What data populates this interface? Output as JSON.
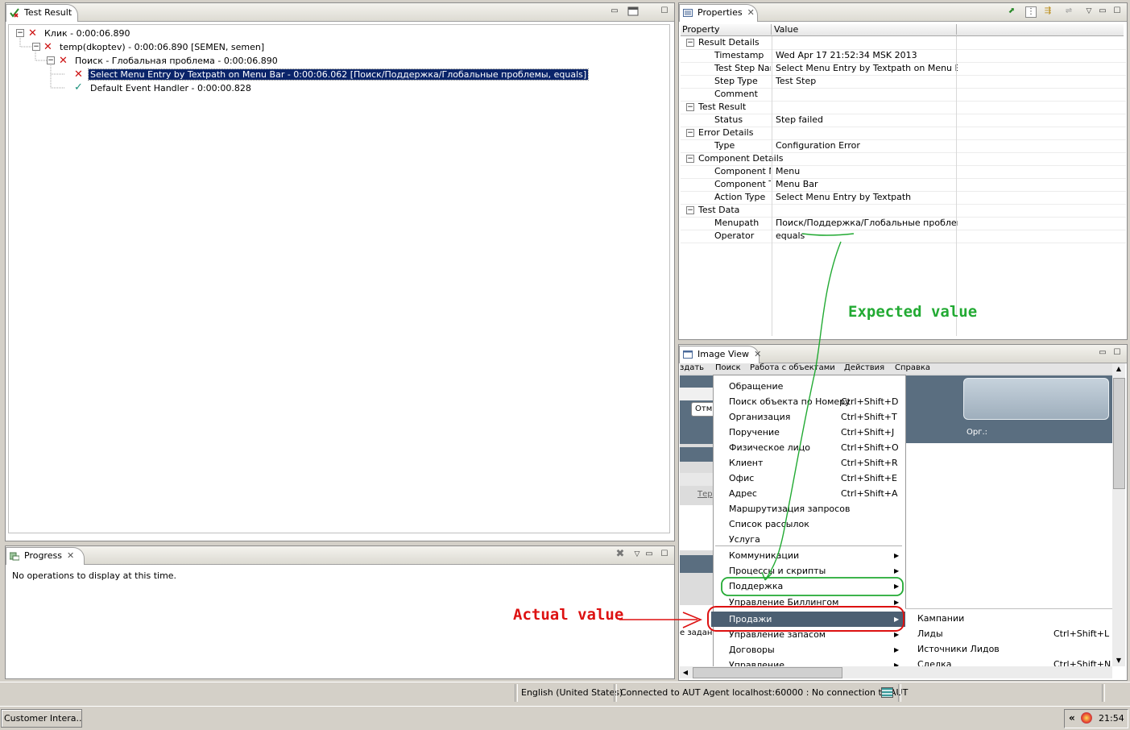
{
  "test_result": {
    "tab_title": "Test Result",
    "tree": [
      {
        "label": "Клик - 0:00:06.890",
        "status": "failed"
      },
      {
        "label": "temp(dkoptev) - 0:00:06.890 [SEMEN, semen]",
        "status": "failed"
      },
      {
        "label": "Поиск - Глобальная проблема - 0:00:06.890",
        "status": "failed"
      },
      {
        "label": "Select Menu Entry by Textpath on Menu Bar - 0:00:06.062 [Поиск/Поддержка/Глобальные проблемы, equals]",
        "status": "failed"
      },
      {
        "label": "Default Event Handler - 0:00:00.828",
        "status": "passed"
      }
    ]
  },
  "progress": {
    "tab_title": "Progress",
    "empty_text": "No operations to display at this time."
  },
  "properties": {
    "tab_title": "Properties",
    "col_property": "Property",
    "col_value": "Value",
    "groups": [
      {
        "name": "Result Details",
        "rows": [
          {
            "prop": "Timestamp",
            "value": "Wed Apr 17 21:52:34 MSK 2013"
          },
          {
            "prop": "Test Step Nam",
            "value": "Select Menu Entry by Textpath on Menu Bar"
          },
          {
            "prop": "Step Type",
            "value": "Test Step"
          },
          {
            "prop": "Comment",
            "value": ""
          }
        ]
      },
      {
        "name": "Test Result",
        "rows": [
          {
            "prop": "Status",
            "value": "Step failed"
          }
        ]
      },
      {
        "name": "Error Details",
        "rows": [
          {
            "prop": "Type",
            "value": "Configuration Error"
          }
        ]
      },
      {
        "name": "Component Details",
        "rows": [
          {
            "prop": "Component Na",
            "value": "Menu"
          },
          {
            "prop": "Component Ty",
            "value": "Menu Bar"
          },
          {
            "prop": "Action Type",
            "value": "Select Menu Entry by Textpath"
          }
        ]
      },
      {
        "name": "Test Data",
        "rows": [
          {
            "prop": "Menupath",
            "value": "Поиск/Поддержка/Глобальные проблемы"
          },
          {
            "prop": "Operator",
            "value": "equals"
          }
        ]
      }
    ]
  },
  "image_view": {
    "tab_title": "Image View",
    "menubar": [
      "здать",
      "Поиск",
      "Работа с объектами",
      "Действия",
      "Справка"
    ],
    "left_fragments": {
      "btn": "Отм",
      "link": "Тер",
      "text": "е задани"
    },
    "field_label": "Орг.:",
    "menu_items": [
      {
        "label": "Обращение",
        "shortcut": "",
        "sub": false
      },
      {
        "label": "Поиск объекта по  Номеру",
        "shortcut": "Ctrl+Shift+D",
        "sub": false
      },
      {
        "label": "Организация",
        "shortcut": "Ctrl+Shift+T",
        "sub": false
      },
      {
        "label": "Поручение",
        "shortcut": "Ctrl+Shift+J",
        "sub": false
      },
      {
        "label": "Физическое лицо",
        "shortcut": "Ctrl+Shift+O",
        "sub": false
      },
      {
        "label": "Клиент",
        "shortcut": "Ctrl+Shift+R",
        "sub": false
      },
      {
        "label": "Офис",
        "shortcut": "Ctrl+Shift+E",
        "sub": false
      },
      {
        "label": "Адрес",
        "shortcut": "Ctrl+Shift+A",
        "sub": false
      },
      {
        "label": "Маршрутизация запросов",
        "shortcut": "",
        "sub": false
      },
      {
        "label": "Список рассылок",
        "shortcut": "",
        "sub": false
      },
      {
        "label": "Услуга",
        "shortcut": "",
        "sub": false
      },
      {
        "label": "Коммуникации",
        "shortcut": "",
        "sub": true
      },
      {
        "label": "Процессы и скрипты",
        "shortcut": "",
        "sub": true
      },
      {
        "label": "Поддержка",
        "shortcut": "",
        "sub": true
      },
      {
        "label": "Управление Биллингом",
        "shortcut": "",
        "sub": true
      },
      {
        "label": "Продажи",
        "shortcut": "",
        "sub": true
      },
      {
        "label": "Управление запасом",
        "shortcut": "",
        "sub": true
      },
      {
        "label": "Договоры",
        "shortcut": "",
        "sub": true
      },
      {
        "label": "Управление",
        "shortcut": "",
        "sub": true
      }
    ],
    "submenu_items": [
      {
        "label": "Кампании",
        "shortcut": ""
      },
      {
        "label": "Лиды",
        "shortcut": "Ctrl+Shift+L"
      },
      {
        "label": "Источники Лидов",
        "shortcut": ""
      },
      {
        "label": "Сделка",
        "shortcut": "Ctrl+Shift+N"
      }
    ]
  },
  "annotations": {
    "expected": "Expected value",
    "actual": "Actual value",
    "expected_color": "#22aa33",
    "actual_color": "#dd1111"
  },
  "statusbar": {
    "locale": "English (United States)",
    "connection": "Connected to AUT Agent localhost:60000 : No connection to AUT"
  },
  "taskbar": {
    "task": "Customer Intera...",
    "tray_chevron": "«",
    "clock": "21:54"
  }
}
